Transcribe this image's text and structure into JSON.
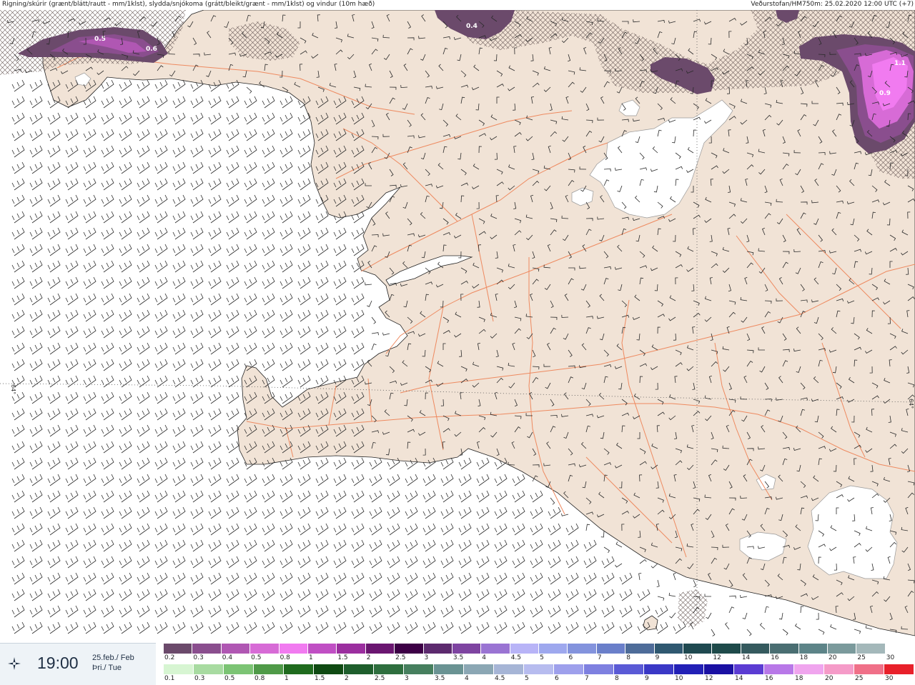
{
  "header": {
    "left_text": "Rigning/skúrir (grænt/blátt/rautt - mm/1klst), slydda/snjókoma (grátt/bleikt/grænt - mm/1klst) og vindur (10m hæð)",
    "right_text": "Veðurstofan/HM750m: 25.02.2020 12:00 UTC (+7)"
  },
  "time_panel": {
    "icon": "compass-star-icon",
    "time": "19:00",
    "date_line1": "25.feb./ Feb",
    "date_line2": "Þri./ Tue"
  },
  "map": {
    "colors": {
      "sea": "#ffffff",
      "land": "#f1e3d6",
      "roads": "#ee8a60",
      "coast": "#2a2a2a",
      "glacier": "#ffffff"
    },
    "precip_labels": [
      "0.5",
      "0.6",
      "0.4",
      "1.1",
      "0.9"
    ],
    "lat_label": "64°"
  },
  "legend_snow": {
    "labels": [
      "0.2",
      "0.3",
      "0.4",
      "0.5",
      "0.8",
      "1",
      "1.5",
      "2",
      "2.5",
      "3",
      "3.5",
      "4",
      "4.5",
      "5",
      "6",
      "7",
      "8",
      "9",
      "10",
      "12",
      "14",
      "16",
      "18",
      "20",
      "25",
      "30"
    ],
    "colors": [
      "#6b4a6b",
      "#8a4e8e",
      "#b057b3",
      "#d76bd6",
      "#f17bf0",
      "#c04fc4",
      "#9b2e9f",
      "#6a1670",
      "#3d0046",
      "#5c2a6e",
      "#7e44a1",
      "#9a74d3",
      "#b8b4f7",
      "#9ea8ee",
      "#8393dd",
      "#6a7fca",
      "#4e6c99",
      "#2f5870",
      "#1f4950",
      "#1e4a4a",
      "#355a5e",
      "#4a6e72",
      "#5d8488",
      "#7b9a9c",
      "#a4b8ba",
      "#ffffff"
    ]
  },
  "legend_rain": {
    "labels": [
      "0.1",
      "0.3",
      "0.5",
      "0.8",
      "1",
      "1.5",
      "2",
      "2.5",
      "3",
      "3.5",
      "4",
      "4.5",
      "5",
      "6",
      "7",
      "8",
      "9",
      "10",
      "12",
      "14",
      "16",
      "18",
      "20",
      "25",
      "30"
    ],
    "colors": [
      "#d7f5d2",
      "#a8dba1",
      "#7cc474",
      "#4f9a48",
      "#1f6b1e",
      "#0f4a12",
      "#1e5e2c",
      "#2e6e3e",
      "#467f5e",
      "#6a9393",
      "#8ba7b4",
      "#a6b5d6",
      "#b7bcef",
      "#9ea0ec",
      "#7e80e0",
      "#5a5ad6",
      "#3a38c6",
      "#2220b6",
      "#1a10a3",
      "#5b3cd3",
      "#b878e8",
      "#f0a5ee",
      "#f59bc8",
      "#f07088",
      "#e8202a"
    ]
  }
}
